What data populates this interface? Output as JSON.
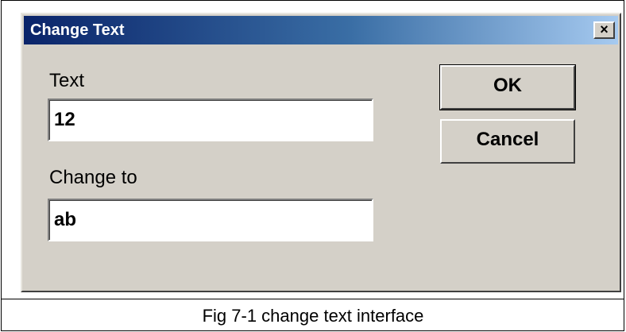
{
  "dialog": {
    "title": "Change Text",
    "close_glyph": "×",
    "fields": {
      "text_label": "Text",
      "text_value": "12",
      "change_label": "Change to",
      "change_value": "ab"
    },
    "buttons": {
      "ok_label": "OK",
      "cancel_label": "Cancel"
    }
  },
  "caption": "Fig 7-1 change text interface",
  "colors": {
    "titlebar_start": "#0a246a",
    "titlebar_end": "#a6caf0",
    "dialog_face": "#d4d0c8"
  }
}
